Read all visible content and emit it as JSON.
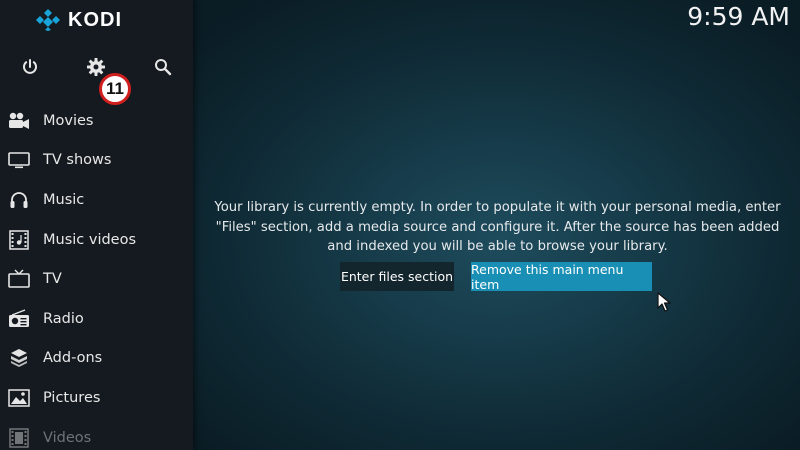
{
  "app": {
    "logo_text": "KODI",
    "clock": "9:59 AM"
  },
  "top_icons": [
    {
      "name": "power-icon"
    },
    {
      "name": "gear-icon"
    },
    {
      "name": "search-icon"
    }
  ],
  "badge": {
    "value": "11"
  },
  "menu": {
    "items": [
      {
        "label": "Movies",
        "icon": "movie-camera-icon"
      },
      {
        "label": "TV shows",
        "icon": "monitor-icon"
      },
      {
        "label": "Music",
        "icon": "headphones-icon"
      },
      {
        "label": "Music videos",
        "icon": "film-strip-icon"
      },
      {
        "label": "TV",
        "icon": "tv-icon"
      },
      {
        "label": "Radio",
        "icon": "radio-icon"
      },
      {
        "label": "Add-ons",
        "icon": "box-icon"
      },
      {
        "label": "Pictures",
        "icon": "picture-icon"
      },
      {
        "label": "Videos",
        "icon": "video-film-icon"
      }
    ]
  },
  "main": {
    "message": "Your library is currently empty. In order to populate it with your personal media, enter \"Files\" section, add a media source and configure it. After the source has been added and indexed you will be able to browse your library.",
    "enter_button": "Enter files section",
    "remove_button": "Remove this main menu item"
  },
  "colors": {
    "accent": "#1a8fb5",
    "sidebar_bg": "#141a1f",
    "badge_border": "#d01f1f"
  }
}
